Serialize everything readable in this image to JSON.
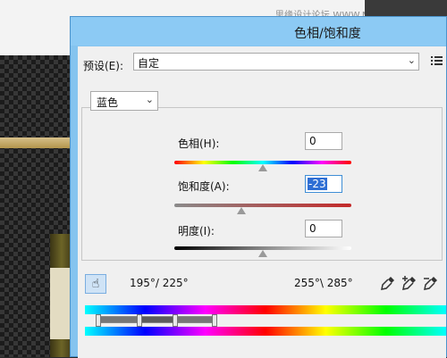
{
  "background": {
    "watermark": "思缘设计论坛  WWW.MISSYUAN.COM"
  },
  "dialog": {
    "title": "色相/饱和度",
    "preset": {
      "label": "预设(E):",
      "value": "自定",
      "menu_icon": "list-menu-icon"
    },
    "channel": {
      "value": "蓝色",
      "arrow_icon": "chevron-down-icon"
    },
    "hue": {
      "label": "色相(H):",
      "value": "0",
      "slider_level": 0.0
    },
    "saturation": {
      "label": "饱和度(A):",
      "value": "-23",
      "slider_level": -0.23
    },
    "lightness": {
      "label": "明度(I):",
      "value": "0",
      "slider_level": 0.0
    },
    "range_left": "195°/ 225°",
    "range_right": "255°\\ 285°",
    "tools": {
      "hand": "hand-target-icon",
      "eyedropper": "eyedropper-icon",
      "eyedropper_add": "eyedropper-plus-icon",
      "eyedropper_subtract": "eyedropper-minus-icon"
    },
    "colors": {
      "title_bar": "#8ccaf4",
      "selection": "#2f6fd4"
    }
  }
}
